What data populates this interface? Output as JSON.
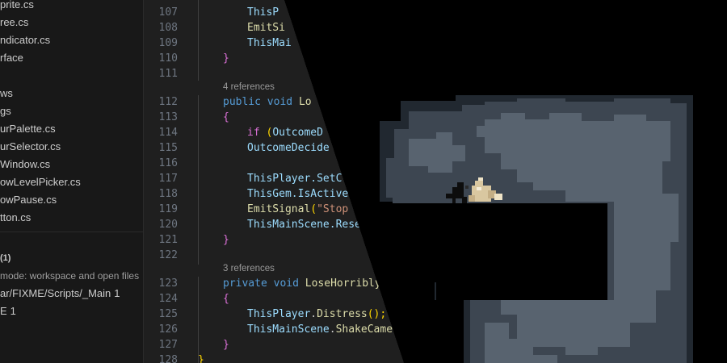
{
  "sidebar": {
    "files": [
      {
        "name": "prite.cs"
      },
      {
        "name": "ree.cs"
      },
      {
        "name": "ndicator.cs"
      },
      {
        "name": "rface"
      },
      {
        "name": "ws"
      },
      {
        "name": "gs"
      },
      {
        "name": "urPalette.cs"
      },
      {
        "name": "urSelector.cs"
      },
      {
        "name": "Window.cs"
      },
      {
        "name": "owLevelPicker.cs"
      },
      {
        "name": "owPause.cs"
      },
      {
        "name": "tton.cs"
      }
    ],
    "problems": {
      "header": "(1)",
      "scope_note": "mode: workspace and open files",
      "entries": [
        {
          "path": "ar/FIXME/Scripts/_Main",
          "count": "1"
        },
        {
          "path": "E",
          "count": "1"
        }
      ]
    }
  },
  "editor": {
    "lines": [
      {
        "num": "107",
        "text": "ThisP"
      },
      {
        "num": "108",
        "text": "EmitSi"
      },
      {
        "num": "109",
        "text": "ThisMai"
      },
      {
        "num": "110",
        "text": "}"
      },
      {
        "num": "111",
        "text": ""
      },
      {
        "lens": "4 references"
      },
      {
        "num": "112",
        "kw1": "public",
        "kw2": "void",
        "name": "Lo"
      },
      {
        "num": "113",
        "text": "{"
      },
      {
        "num": "114",
        "kw": "if",
        "paren": "(",
        "ident": "OutcomeD"
      },
      {
        "num": "115",
        "text": "OutcomeDecide"
      },
      {
        "num": "116",
        "text": ""
      },
      {
        "num": "117",
        "text": "ThisPlayer.SetC"
      },
      {
        "num": "118",
        "text": "ThisGem.IsActive"
      },
      {
        "num": "119",
        "fn": "EmitSignal",
        "paren": "(",
        "str": "\"Stop"
      },
      {
        "num": "120",
        "text": "ThisMainScene.Rese"
      },
      {
        "num": "121",
        "text": "}"
      },
      {
        "num": "122",
        "text": ""
      },
      {
        "lens": "3 references"
      },
      {
        "num": "123",
        "kw1": "private",
        "kw2": "void",
        "name": "LoseHorribly"
      },
      {
        "num": "124",
        "text": "{"
      },
      {
        "num": "125",
        "obj": "ThisPlayer",
        "method": "Distress",
        "tail": "();"
      },
      {
        "num": "126",
        "obj": "ThisMainScene",
        "method": "ShakeCamer",
        "tail": ""
      },
      {
        "num": "127",
        "text": "}"
      },
      {
        "num": "128",
        "text": "}"
      }
    ]
  },
  "colors": {
    "keyword": "#569cd6",
    "function": "#dcdcaa",
    "identifier": "#9cdcfe",
    "string": "#ce9178",
    "bracket_level1": "#da70d6",
    "bracket_level2": "#ffd700",
    "line_number": "#6e7681",
    "cave_mid": "#3d4651",
    "cave_light": "#58636f",
    "cave_dark": "#212830",
    "background_black": "#000000"
  },
  "game": {
    "characters": [
      "crow-sprite",
      "creature-sprite"
    ]
  }
}
